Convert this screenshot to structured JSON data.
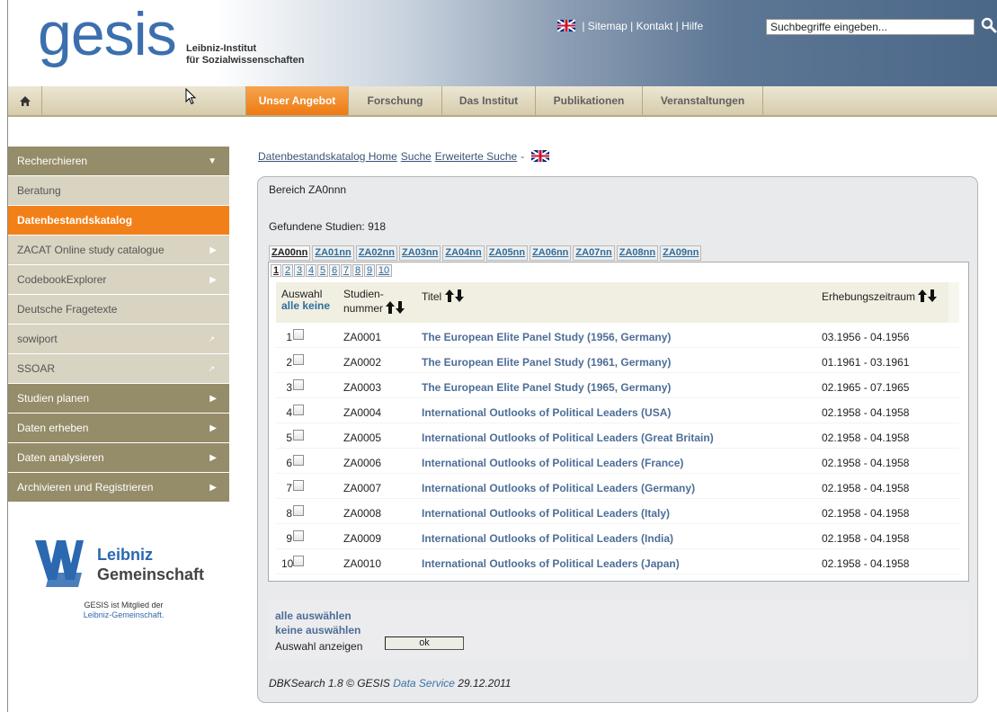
{
  "header": {
    "logo": "gesis",
    "subtitle_line1": "Leibniz-Institut",
    "subtitle_line2": "für Sozialwissenschaften",
    "top_links": [
      "Sitemap",
      "Kontakt",
      "Hilfe"
    ],
    "search_placeholder": "Suchbegriffe eingeben...",
    "search_icon": "search-icon"
  },
  "nav": {
    "tabs": [
      {
        "label": "Unser Angebot",
        "active": true
      },
      {
        "label": "Forschung"
      },
      {
        "label": "Das Institut"
      },
      {
        "label": "Publikationen"
      },
      {
        "label": "Veranstaltungen"
      }
    ]
  },
  "sidebar": {
    "items": [
      {
        "label": "Recherchieren",
        "style": "dark",
        "icon": "triangle-down"
      },
      {
        "label": "Beratung",
        "style": "light"
      },
      {
        "label": "Datenbestandskatalog",
        "style": "active"
      },
      {
        "label": "ZACAT Online study catalogue",
        "style": "light",
        "icon": "triangle-right"
      },
      {
        "label": "CodebookExplorer",
        "style": "light",
        "icon": "triangle-right"
      },
      {
        "label": "Deutsche Fragetexte",
        "style": "light"
      },
      {
        "label": "sowiport",
        "style": "light",
        "icon": "external-link"
      },
      {
        "label": "SSOAR",
        "style": "light",
        "icon": "external-link"
      },
      {
        "label": "Studien planen",
        "style": "dark",
        "icon": "triangle-right"
      },
      {
        "label": "Daten erheben",
        "style": "dark",
        "icon": "triangle-right"
      },
      {
        "label": "Daten analysieren",
        "style": "dark",
        "icon": "triangle-right"
      },
      {
        "label": "Archivieren und Registrieren",
        "style": "dark",
        "icon": "triangle-right"
      }
    ],
    "leibniz": {
      "line1": "Leibniz",
      "line2": "Gemeinschaft",
      "note": "GESIS ist Mitglied der",
      "note_link": "Leibniz-Gemeinschaft."
    }
  },
  "content": {
    "breadcrumb": [
      "Datenbestandskatalog Home",
      "Suche",
      "Erweiterte Suche"
    ],
    "breadcrumb_sep": "-",
    "panel_title": "Bereich ZA0nnn",
    "found": "Gefundene Studien: 918",
    "tabs": [
      "ZA00nn",
      "ZA01nn",
      "ZA02nn",
      "ZA03nn",
      "ZA04nn",
      "ZA05nn",
      "ZA06nn",
      "ZA07nn",
      "ZA08nn",
      "ZA09nn"
    ],
    "active_tab": 0,
    "pages": [
      "1",
      "2",
      "3",
      "4",
      "5",
      "6",
      "7",
      "8",
      "9",
      "10"
    ],
    "active_page": 0,
    "columns": {
      "auswahl": "Auswahl",
      "alle": "alle",
      "keine": "keine",
      "studien1": "Studien-",
      "studien2": "nummer",
      "titel": "Titel",
      "zeitraum": "Erhebungszeitraum"
    },
    "rows": [
      {
        "n": "1",
        "id": "ZA0001",
        "title": "The European Elite Panel Study (1956, Germany)",
        "period": "03.1956 - 04.1956"
      },
      {
        "n": "2",
        "id": "ZA0002",
        "title": "The European Elite Panel Study (1961, Germany)",
        "period": "01.1961 - 03.1961"
      },
      {
        "n": "3",
        "id": "ZA0003",
        "title": "The European Elite Panel Study (1965, Germany)",
        "period": "02.1965 - 07.1965"
      },
      {
        "n": "4",
        "id": "ZA0004",
        "title": "International Outlooks of Political Leaders (USA)",
        "period": "02.1958 - 04.1958"
      },
      {
        "n": "5",
        "id": "ZA0005",
        "title": "International Outlooks of Political Leaders (Great Britain)",
        "period": "02.1958 - 04.1958"
      },
      {
        "n": "6",
        "id": "ZA0006",
        "title": "International Outlooks of Political Leaders (France)",
        "period": "02.1958 - 04.1958"
      },
      {
        "n": "7",
        "id": "ZA0007",
        "title": "International Outlooks of Political Leaders (Germany)",
        "period": "02.1958 - 04.1958"
      },
      {
        "n": "8",
        "id": "ZA0008",
        "title": "International Outlooks of Political Leaders (Italy)",
        "period": "02.1958 - 04.1958"
      },
      {
        "n": "9",
        "id": "ZA0009",
        "title": "International Outlooks of Political Leaders (India)",
        "period": "02.1958 - 04.1958"
      },
      {
        "n": "10",
        "id": "ZA0010",
        "title": "International Outlooks of Political Leaders (Japan)",
        "period": "02.1958 - 04.1958"
      }
    ],
    "actions": {
      "select_all": "alle auswählen",
      "select_none": "keine auswählen",
      "show_label": "Auswahl anzeigen",
      "ok": "ok"
    },
    "footer": {
      "prefix": "DBKSearch 1.8 © GESIS",
      "link": "Data Service",
      "date": "29.12.2011"
    }
  }
}
